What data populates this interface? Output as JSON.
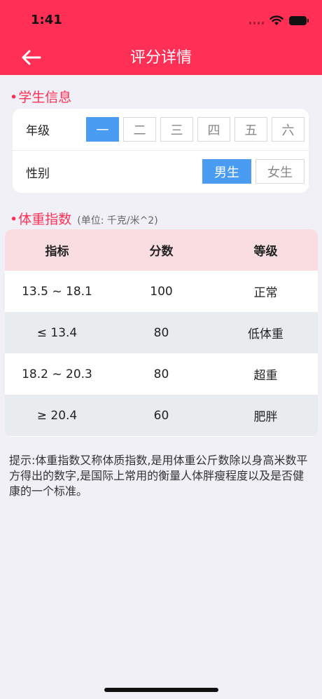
{
  "status_bar": {
    "time": "1:41"
  },
  "nav": {
    "title": "评分详情"
  },
  "student_section": {
    "title": "学生信息",
    "grade_label": "年级",
    "grades": [
      "一",
      "二",
      "三",
      "四",
      "五",
      "六"
    ],
    "gender_label": "性别",
    "genders": [
      "男生",
      "女生"
    ]
  },
  "bmi_section": {
    "title": "体重指数",
    "unit": "(单位: 千克/米^2)"
  },
  "table": {
    "headers": [
      "指标",
      "分数",
      "等级"
    ],
    "rows": [
      [
        "13.5 ~ 18.1",
        "100",
        "正常"
      ],
      [
        "≤ 13.4",
        "80",
        "低体重"
      ],
      [
        "18.2 ~ 20.3",
        "80",
        "超重"
      ],
      [
        "≥ 20.4",
        "60",
        "肥胖"
      ]
    ]
  },
  "tip": "提示:体重指数又称体质指数,是用体重公斤数除以身高米数平方得出的数字,是国际上常用的衡量人体胖瘦程度以及是否健康的一个标准。",
  "colors": {
    "accent": "#ff2f55",
    "selected": "#4a9cf2"
  }
}
